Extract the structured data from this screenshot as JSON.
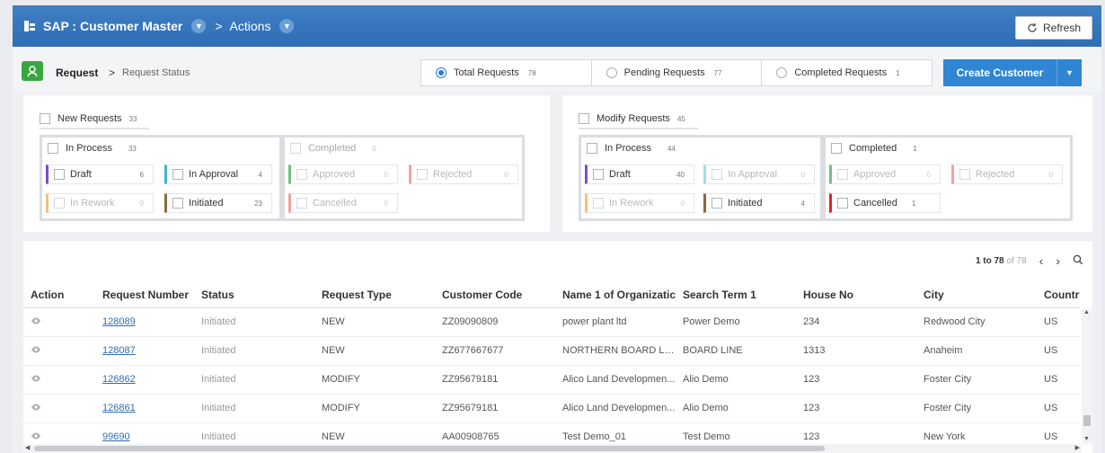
{
  "header": {
    "app_title": "SAP : Customer Master",
    "separator": ">",
    "breadcrumb_actions": "Actions",
    "refresh_label": "Refresh",
    "brand_color": "#2f6db4"
  },
  "subheader": {
    "request_label": "Request",
    "arrow": ">",
    "status_label": "Request Status",
    "filters": [
      {
        "label": "Total Requests",
        "count": "78",
        "selected": true
      },
      {
        "label": "Pending Requests",
        "count": "77",
        "selected": false
      },
      {
        "label": "Completed Requests",
        "count": "1",
        "selected": false
      }
    ],
    "create_label": "Create Customer"
  },
  "new_requests": {
    "title": "New Requests",
    "count": "33",
    "in_process": {
      "label": "In Process",
      "count": "33"
    },
    "completed": {
      "label": "Completed",
      "count": "0"
    },
    "draft": {
      "label": "Draft",
      "count": "6",
      "color": "#7b4fc8"
    },
    "in_approval": {
      "label": "In Approval",
      "count": "4",
      "color": "#3fb6c8"
    },
    "in_rework": {
      "label": "In Rework",
      "count": "0",
      "color": "#f0c27a"
    },
    "initiated": {
      "label": "Initiated",
      "count": "23",
      "color": "#8a6a3f"
    },
    "approved": {
      "label": "Approved",
      "count": "0",
      "color": "#6fc27a"
    },
    "rejected": {
      "label": "Rejected",
      "count": "0",
      "color": "#f2a3a3"
    },
    "cancelled": {
      "label": "Cancelled",
      "count": "0",
      "color": "#f3a0a0"
    }
  },
  "modify_requests": {
    "title": "Modify Requests",
    "count": "45",
    "in_process": {
      "label": "In Process",
      "count": "44"
    },
    "completed": {
      "label": "Completed",
      "count": "1"
    },
    "draft": {
      "label": "Draft",
      "count": "40",
      "color": "#7b4fc8"
    },
    "in_approval": {
      "label": "In Approval",
      "count": "0",
      "color": "#9fdfe8"
    },
    "in_rework": {
      "label": "In Rework",
      "count": "0",
      "color": "#f0c27a"
    },
    "initiated": {
      "label": "Initiated",
      "count": "4",
      "color": "#8a6a3f"
    },
    "approved": {
      "label": "Approved",
      "count": "0",
      "color": "#6fc27a"
    },
    "rejected": {
      "label": "Rejected",
      "count": "0",
      "color": "#f2a3a3"
    },
    "cancelled": {
      "label": "Cancelled",
      "count": "1",
      "color": "#e02424"
    }
  },
  "table": {
    "pager_range": "1 to 78",
    "pager_of": "of 78",
    "columns": [
      "Action",
      "Request Number",
      "Status",
      "Request Type",
      "Customer Code",
      "Name 1 of Organizatic",
      "Search Term 1",
      "House No",
      "City",
      "Country"
    ],
    "rows": [
      {
        "req": "128089",
        "status": "Initiated",
        "type": "NEW",
        "code": "ZZ09090809",
        "name": "power plant ltd",
        "term": "Power Demo",
        "house": "234",
        "city": "Redwood City",
        "country": "US"
      },
      {
        "req": "128087",
        "status": "Initiated",
        "type": "NEW",
        "code": "ZZ677667677",
        "name": "NORTHERN BOARD LINE",
        "term": "BOARD LINE",
        "house": "1313",
        "city": "Anaheim",
        "country": "US"
      },
      {
        "req": "126862",
        "status": "Initiated",
        "type": "MODIFY",
        "code": "ZZ95679181",
        "name": "Alico Land Developmen...",
        "term": "Alio Demo",
        "house": "123",
        "city": "Foster City",
        "country": "US"
      },
      {
        "req": "126861",
        "status": "Initiated",
        "type": "MODIFY",
        "code": "ZZ95679181",
        "name": "Alico Land Developmen...",
        "term": "Alio Demo",
        "house": "123",
        "city": "Foster City",
        "country": "US"
      },
      {
        "req": "99690",
        "status": "Initiated",
        "type": "NEW",
        "code": "AA00908765",
        "name": "Test Demo_01",
        "term": "Test Demo",
        "house": "123",
        "city": "New York",
        "country": "US"
      }
    ]
  }
}
